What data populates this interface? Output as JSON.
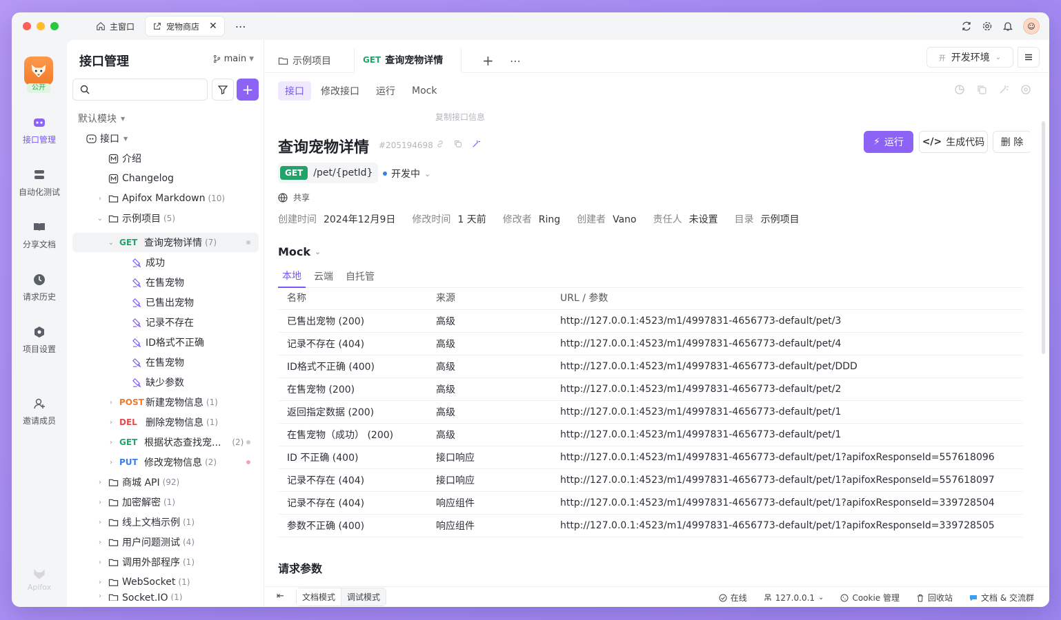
{
  "window_tabs": [
    {
      "label": "主窗口"
    },
    {
      "label": "宠物商店"
    }
  ],
  "rail": {
    "badge": "公开",
    "items": [
      "接口管理",
      "自动化测试",
      "分享文档",
      "请求历史",
      "项目设置",
      "邀请成员"
    ],
    "footer": "Apifox"
  },
  "sidebar": {
    "title": "接口管理",
    "branch": "main",
    "search_placeholder": "",
    "tree": [
      {
        "label": "默认模块",
        "type": "module"
      },
      {
        "label": "接口",
        "type": "root"
      },
      {
        "label": "介绍",
        "type": "doc"
      },
      {
        "label": "Changelog",
        "type": "doc"
      },
      {
        "label": "Apifox Markdown",
        "count": "(10)",
        "type": "folder"
      },
      {
        "label": "示例项目",
        "count": "(5)",
        "type": "folder"
      },
      {
        "method": "GET",
        "label": "查询宠物详情",
        "count": "(7)",
        "type": "api"
      },
      {
        "label": "成功",
        "type": "case"
      },
      {
        "label": "在售宠物",
        "type": "case"
      },
      {
        "label": "已售出宠物",
        "type": "case"
      },
      {
        "label": "记录不存在",
        "type": "case"
      },
      {
        "label": "ID格式不正确",
        "type": "case"
      },
      {
        "label": "在售宠物",
        "type": "case"
      },
      {
        "label": "缺少参数",
        "type": "case"
      },
      {
        "method": "POST",
        "label": "新建宠物信息",
        "count": "(1)",
        "type": "api"
      },
      {
        "method": "DEL",
        "label": "删除宠物信息",
        "count": "(1)",
        "type": "api"
      },
      {
        "method": "GET",
        "label": "根据状态查找宠...",
        "count": "(2)",
        "type": "api"
      },
      {
        "method": "PUT",
        "label": "修改宠物信息",
        "count": "(2)",
        "type": "api"
      },
      {
        "label": "商城 API",
        "count": "(92)",
        "type": "folder"
      },
      {
        "label": "加密解密",
        "count": "(1)",
        "type": "folder"
      },
      {
        "label": "线上文档示例",
        "count": "(1)",
        "type": "folder"
      },
      {
        "label": "用户问题测试",
        "count": "(4)",
        "type": "folder"
      },
      {
        "label": "调用外部程序",
        "count": "(1)",
        "type": "folder"
      },
      {
        "label": "WebSocket",
        "count": "(1)",
        "type": "folder"
      },
      {
        "label": "Socket.IO",
        "count": "(1)",
        "type": "folder"
      }
    ]
  },
  "main": {
    "tabs": [
      {
        "label": "示例项目"
      },
      {
        "method": "GET",
        "label": "查询宠物详情"
      }
    ],
    "env": {
      "prefix": "开",
      "label": "开发环境"
    },
    "subtabs": [
      "接口",
      "修改接口",
      "运行",
      "Mock"
    ],
    "tooltip": "复制接口信息",
    "api": {
      "title": "查询宠物详情",
      "id": "#205194698",
      "method": "GET",
      "path": "/pet/{petId}",
      "status": "开发中",
      "share": "共享",
      "meta": [
        {
          "k": "创建时间",
          "v": "2024年12月9日"
        },
        {
          "k": "修改时间",
          "v": "1 天前"
        },
        {
          "k": "修改者",
          "v": "Ring"
        },
        {
          "k": "创建者",
          "v": "Vano"
        },
        {
          "k": "责任人",
          "v": "未设置"
        },
        {
          "k": "目录",
          "v": "示例项目"
        }
      ]
    },
    "buttons": {
      "run": "运行",
      "code": "生成代码",
      "delete": "删 除"
    },
    "mock": {
      "heading": "Mock",
      "tabs": [
        "本地",
        "云端",
        "自托管"
      ],
      "columns": [
        "名称",
        "来源",
        "URL / 参数"
      ],
      "rows": [
        [
          "已售出宠物 (200)",
          "高级",
          "http://127.0.0.1:4523/m1/4997831-4656773-default/pet/3"
        ],
        [
          "记录不存在 (404)",
          "高级",
          "http://127.0.0.1:4523/m1/4997831-4656773-default/pet/4"
        ],
        [
          "ID格式不正确 (400)",
          "高级",
          "http://127.0.0.1:4523/m1/4997831-4656773-default/pet/DDD"
        ],
        [
          "在售宠物 (200)",
          "高级",
          "http://127.0.0.1:4523/m1/4997831-4656773-default/pet/2"
        ],
        [
          "返回指定数据 (200)",
          "高级",
          "http://127.0.0.1:4523/m1/4997831-4656773-default/pet/1"
        ],
        [
          "在售宠物（成功） (200)",
          "高级",
          "http://127.0.0.1:4523/m1/4997831-4656773-default/pet/1"
        ],
        [
          "ID 不正确 (400)",
          "接口响应",
          "http://127.0.0.1:4523/m1/4997831-4656773-default/pet/1?apifoxResponseId=557618096"
        ],
        [
          "记录不存在 (404)",
          "接口响应",
          "http://127.0.0.1:4523/m1/4997831-4656773-default/pet/1?apifoxResponseId=557618097"
        ],
        [
          "记录不存在 (404)",
          "响应组件",
          "http://127.0.0.1:4523/m1/4997831-4656773-default/pet/1?apifoxResponseId=339728504"
        ],
        [
          "参数不正确 (400)",
          "响应组件",
          "http://127.0.0.1:4523/m1/4997831-4656773-default/pet/1?apifoxResponseId=339728505"
        ]
      ]
    },
    "request_params": "请求参数"
  },
  "statusbar": {
    "modes": [
      "文档模式",
      "调试模式"
    ],
    "items": [
      "在线",
      "127.0.0.1",
      "Cookie 管理",
      "回收站",
      "文档 & 交流群"
    ]
  }
}
